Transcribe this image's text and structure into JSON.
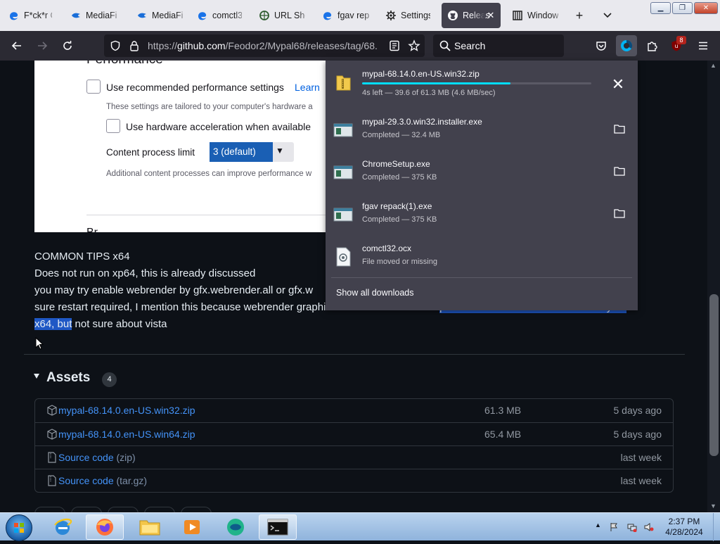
{
  "browser": {
    "tabs": [
      {
        "label": "F*ck*r G",
        "icon": "edge-icon",
        "active": false
      },
      {
        "label": "MediaFi",
        "icon": "mediafire-icon",
        "active": false
      },
      {
        "label": "MediaFir",
        "icon": "mediafire-icon",
        "active": false
      },
      {
        "label": "comctl3",
        "icon": "edge-icon",
        "active": false
      },
      {
        "label": "URL Sho",
        "icon": "globe-icon",
        "active": false
      },
      {
        "label": "fgav rep",
        "icon": "edge-icon",
        "active": false
      },
      {
        "label": "Settings",
        "icon": "gear-icon",
        "active": false
      },
      {
        "label": "Releas",
        "icon": "github-icon",
        "active": true
      },
      {
        "label": "Window",
        "icon": "bookmark-icon",
        "active": false
      }
    ],
    "url_host": "github.com",
    "url_prefix": "https://",
    "url_path": "/Feodor2/Mypal68/releases/tag/68.",
    "search_placeholder": "Search",
    "extension_badge": "8"
  },
  "settings_screenshot": {
    "section_title": "Performance",
    "recommended_label": "Use recommended performance settings",
    "learn_more": "Learn",
    "tailored_note": "These settings are tailored to your computer's hardware a",
    "hw_accel_label": "Use hardware acceleration when available",
    "content_process_label": "Content process limit",
    "content_process_value": "3 (default)",
    "additional_note": "Additional content processes can improve performance w",
    "next_section_cut": "Br"
  },
  "release_notes": {
    "line1": "COMMON TIPS x64",
    "line2": "Does not run on xp64, this is already discussed",
    "line3": "you may try enable webrender by gfx.webrender.all or gfx.w",
    "line4_plain": "sure restart required, I mention this because webrender graphics turned to have better ",
    "line4_highlight": "performance and well usable already on",
    "line5_highlight": "x64, but",
    "line5_plain": " not sure about vista"
  },
  "assets": {
    "title": "Assets",
    "count": "4",
    "rows": [
      {
        "name": "mypal-68.14.0.en-US.win32.zip",
        "suffix": "",
        "size": "61.3 MB",
        "date": "5 days ago",
        "icon": "package-icon"
      },
      {
        "name": "mypal-68.14.0.en-US.win64.zip",
        "suffix": "",
        "size": "65.4 MB",
        "date": "5 days ago",
        "icon": "package-icon"
      },
      {
        "name": "Source code",
        "suffix": " (zip)",
        "size": "",
        "date": "last week",
        "icon": "file-zip-icon"
      },
      {
        "name": "Source code",
        "suffix": " (tar.gz)",
        "size": "",
        "date": "last week",
        "icon": "file-zip-icon"
      }
    ]
  },
  "downloads": {
    "items": [
      {
        "name": "mypal-68.14.0.en-US.win32.zip",
        "status": "4s left — 39.6 of 61.3 MB (4.6 MB/sec)",
        "progress": 0.646,
        "in_progress": true,
        "icon": "zip-folder-icon"
      },
      {
        "name": "mypal-29.3.0.win32.installer.exe",
        "status": "Completed — 32.4 MB",
        "in_progress": false,
        "icon": "exe-file-icon"
      },
      {
        "name": "ChromeSetup.exe",
        "status": "Completed — 375 KB",
        "in_progress": false,
        "icon": "exe-file-icon"
      },
      {
        "name": "fgav repack(1).exe",
        "status": "Completed — 375 KB",
        "in_progress": false,
        "icon": "exe-file-icon"
      },
      {
        "name": "comctl32.ocx",
        "status": "File moved or missing",
        "in_progress": false,
        "icon": "ocx-file-icon"
      }
    ],
    "show_all": "Show all downloads"
  },
  "taskbar": {
    "time": "2:37 PM",
    "date": "4/28/2024"
  },
  "colors": {
    "accent": "#00ddff",
    "link": "#4493f8",
    "selection": "#1f58c5",
    "page_bg": "#0d1117",
    "panel_bg": "#42414d"
  }
}
